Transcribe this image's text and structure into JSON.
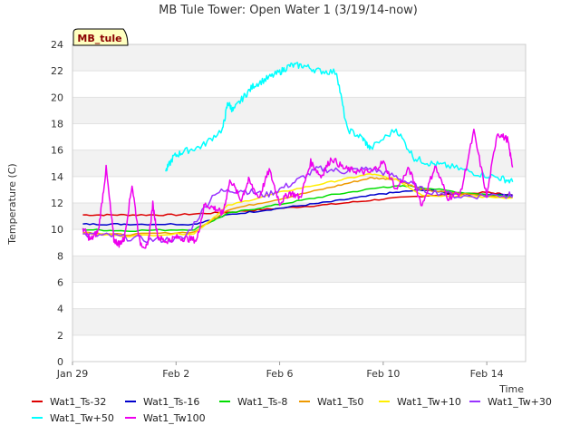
{
  "chart_data": {
    "type": "line",
    "title": "MB Tule Tower: Open Water 1 (3/19/14-now)",
    "xlabel": "Time",
    "ylabel": "Temperature (C)",
    "badge": "MB_tule",
    "ylim": [
      0,
      24
    ],
    "xlim": [
      0,
      17.5
    ],
    "x_tick_values": [
      0,
      4,
      8,
      12,
      16
    ],
    "x_tick_labels": [
      "Jan 29",
      "Feb 2",
      "Feb 6",
      "Feb 10",
      "Feb 14"
    ],
    "y_ticks": [
      0,
      2,
      4,
      6,
      8,
      10,
      12,
      14,
      16,
      18,
      20,
      22,
      24
    ],
    "grid": "horizontal bands",
    "legend_position": "bottom",
    "series": [
      {
        "name": "Wat1_Ts-32",
        "color": "#dd0000",
        "x": [
          0.4,
          2,
          4,
          6,
          8,
          10,
          12,
          14,
          16,
          17
        ],
        "y": [
          11.1,
          11.1,
          11.1,
          11.3,
          11.6,
          11.9,
          12.3,
          12.6,
          12.8,
          12.6
        ]
      },
      {
        "name": "Wat1_Ts-16",
        "color": "#0000cc",
        "x": [
          0.4,
          2,
          4.7,
          6,
          8,
          10,
          12,
          13.5,
          15,
          17
        ],
        "y": [
          10.4,
          10.4,
          10.4,
          11.1,
          11.6,
          12.1,
          12.7,
          13.0,
          12.7,
          12.6
        ]
      },
      {
        "name": "Wat1_Ts-8",
        "color": "#00dd00",
        "x": [
          0.4,
          2,
          4.7,
          6,
          8,
          10,
          12,
          13,
          15,
          17
        ],
        "y": [
          10.0,
          9.9,
          10.0,
          11.2,
          11.9,
          12.6,
          13.2,
          13.3,
          12.8,
          12.5
        ]
      },
      {
        "name": "Wat1_Ts0",
        "color": "#ee9900",
        "x": [
          0.4,
          2,
          4.7,
          6,
          8,
          10,
          11.5,
          12.5,
          13.5,
          15,
          17
        ],
        "y": [
          9.8,
          9.6,
          9.8,
          11.5,
          12.3,
          13.2,
          13.9,
          13.8,
          13.0,
          12.7,
          12.4
        ]
      },
      {
        "name": "Wat1_Tw+10",
        "color": "#ffee00",
        "x": [
          0.4,
          2,
          4.7,
          6,
          8,
          10,
          11.5,
          12.5,
          13.5,
          15,
          17
        ],
        "y": [
          9.7,
          9.5,
          9.7,
          11.8,
          12.8,
          13.6,
          14.2,
          13.8,
          12.6,
          12.5,
          12.4
        ]
      },
      {
        "name": "Wat1_Tw+30",
        "color": "#9933ff",
        "x": [
          0.4,
          1.5,
          3,
          4.3,
          5.5,
          6.5,
          7.5,
          8.5,
          9.5,
          10.5,
          11.5,
          12.5,
          13.5,
          15,
          16.5,
          17
        ],
        "y": [
          9.6,
          9.5,
          9.2,
          9.3,
          12.8,
          13.0,
          12.6,
          13.5,
          14.6,
          14.4,
          14.6,
          14.0,
          13.0,
          12.5,
          12.6,
          12.6
        ]
      },
      {
        "name": "Wat1_Tw+50",
        "color": "#00ffff",
        "x": [
          3.6,
          3.9,
          4.3,
          5.0,
          5.8,
          6.0,
          6.2,
          6.6,
          7.0,
          7.5,
          8.0,
          8.4,
          8.9,
          9.5,
          10.2,
          10.6,
          11.2,
          11.5,
          12.5,
          13.2,
          13.8,
          14.5,
          15.5,
          16.5,
          17.0
        ],
        "y": [
          14.4,
          15.5,
          15.9,
          16.3,
          17.6,
          19.6,
          19.0,
          20.0,
          20.9,
          21.4,
          21.9,
          22.4,
          22.4,
          22.0,
          21.9,
          17.6,
          16.9,
          16.1,
          17.6,
          15.4,
          15.0,
          14.8,
          14.3,
          13.9,
          13.6
        ]
      },
      {
        "name": "Wat1_Tw100",
        "color": "#ee00ee",
        "x": [
          0.4,
          0.7,
          1.0,
          1.3,
          1.6,
          1.8,
          2.0,
          2.3,
          2.6,
          2.9,
          3.1,
          3.3,
          3.6,
          4.0,
          4.4,
          4.8,
          5.1,
          5.5,
          5.8,
          6.1,
          6.5,
          6.8,
          7.2,
          7.6,
          8.0,
          8.4,
          8.8,
          9.2,
          9.6,
          10.0,
          10.5,
          11.0,
          11.5,
          12.0,
          12.5,
          13.0,
          13.5,
          14.0,
          14.5,
          15.0,
          15.5,
          16.0,
          16.4,
          16.8,
          17.0
        ],
        "y": [
          10.1,
          9.2,
          9.9,
          14.6,
          9.2,
          8.9,
          9.3,
          13.4,
          9.0,
          8.6,
          11.9,
          9.4,
          9.1,
          9.4,
          9.3,
          9.2,
          11.9,
          11.6,
          11.2,
          13.8,
          12.2,
          13.7,
          12.4,
          14.5,
          12.0,
          12.8,
          12.4,
          15.1,
          14.0,
          15.4,
          14.6,
          14.4,
          14.3,
          15.1,
          13.0,
          14.6,
          11.8,
          14.8,
          12.4,
          12.8,
          17.4,
          12.5,
          17.3,
          16.8,
          14.7
        ]
      }
    ]
  }
}
